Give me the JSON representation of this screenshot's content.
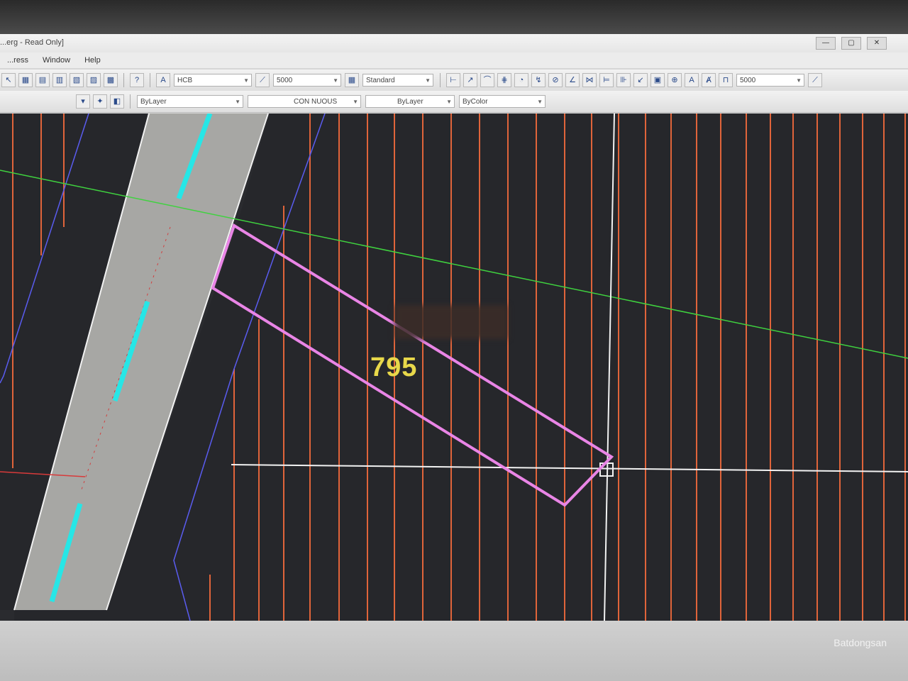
{
  "window": {
    "title_fragment": "...erg - Read Only]",
    "controls": [
      "—",
      "▢",
      "✕"
    ]
  },
  "menu": {
    "items": [
      "...ress",
      "Window",
      "Help"
    ]
  },
  "toolbar1": {
    "text_style_combo": "HCB",
    "dim_scale_combo": "5000",
    "style_combo": "Standard",
    "right_scale_combo": "5000"
  },
  "toolbar2": {
    "layer_combo": "ByLayer",
    "linetype_combo": "CON  NUOUS",
    "lineweight_combo": "ByLayer",
    "color_combo": "ByColor"
  },
  "drawing": {
    "lot_number": "795",
    "colors": {
      "background": "#26272b",
      "grid_lines": "#e0643a",
      "road": "#a7a7a4",
      "lane_marks": "#27e6e6",
      "boundary_blue": "#5a5cf0",
      "parcel": "#e985e6",
      "green_axis": "#3fd23f",
      "crosshair": "#f2f2f2",
      "red_axis": "#d83a3a",
      "lot_text": "#e8d84a"
    }
  },
  "watermark": {
    "text": "Batdongsan"
  }
}
